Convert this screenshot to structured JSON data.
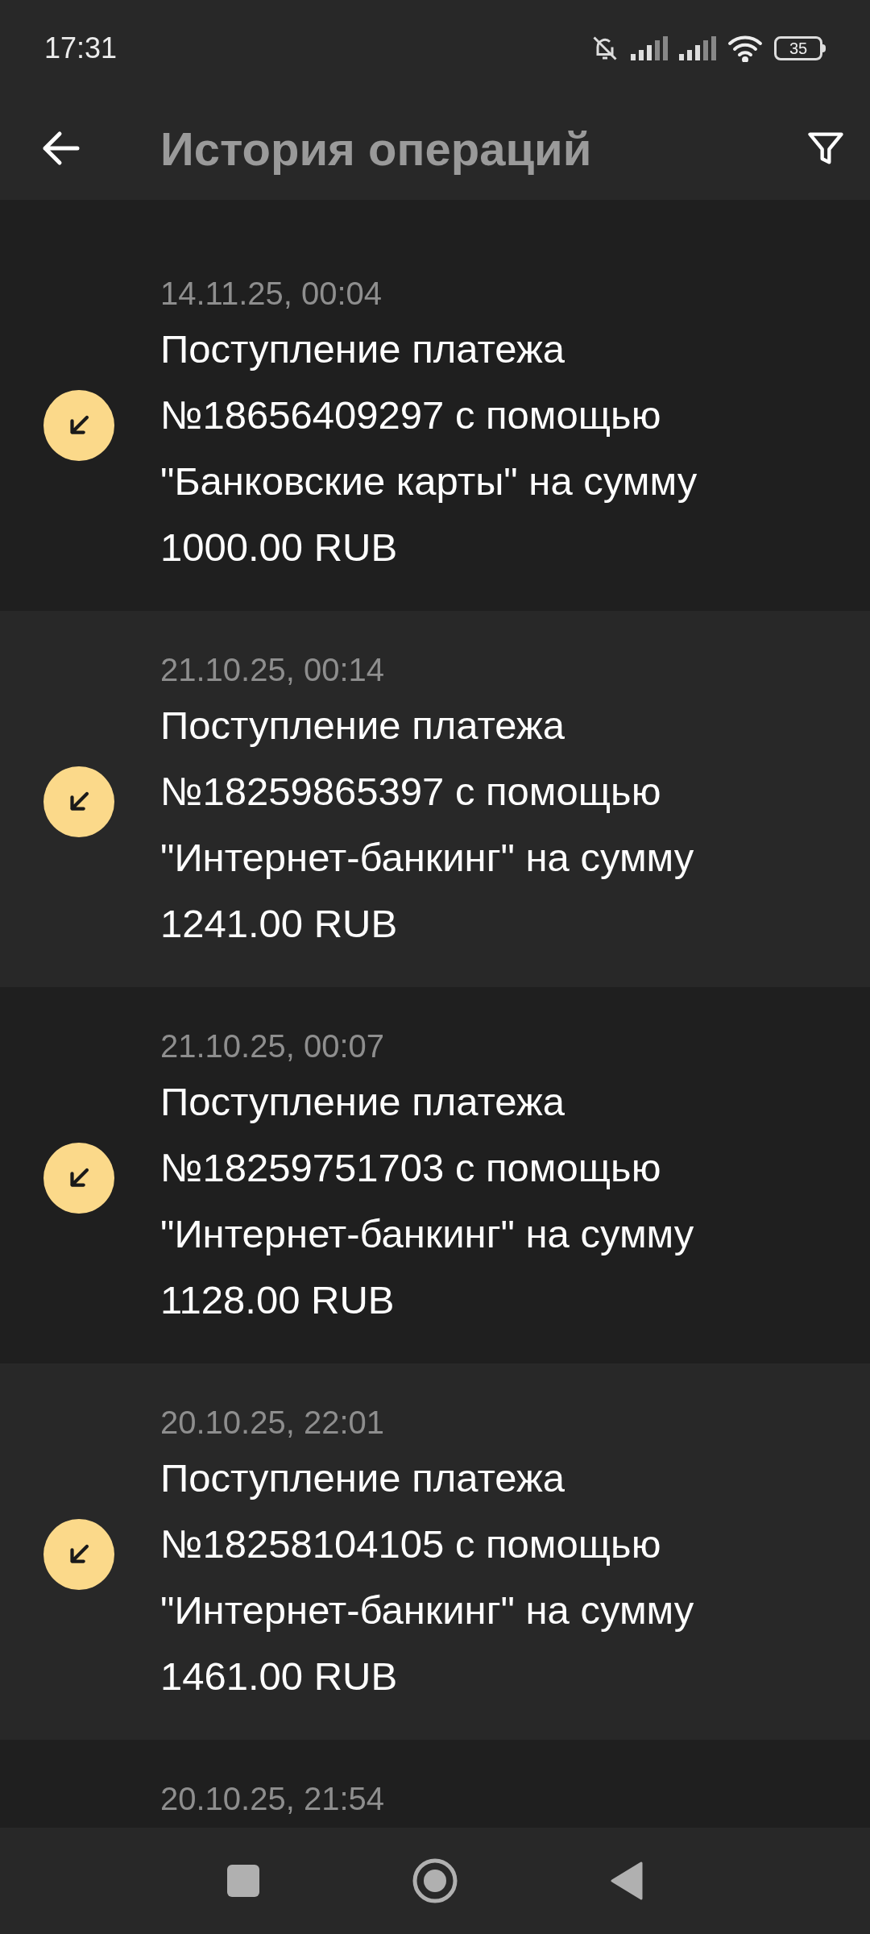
{
  "status_bar": {
    "time": "17:31",
    "battery": "35"
  },
  "header": {
    "title": "История операций"
  },
  "operations": [
    {
      "date": "14.11.25, 00:04",
      "text": "Поступление платежа №18656409297 с помощью \"Банковские карты\" на сумму 1000.00 RUB"
    },
    {
      "date": "21.10.25, 00:14",
      "text": "Поступление платежа №18259865397 с помощью \"Интернет-банкинг\" на сумму 1241.00 RUB"
    },
    {
      "date": "21.10.25, 00:07",
      "text": "Поступление платежа №18259751703 с помощью \"Интернет-банкинг\" на сумму 1128.00 RUB"
    },
    {
      "date": "20.10.25, 22:01",
      "text": "Поступление платежа №18258104105 с помощью \"Интернет-банкинг\" на сумму 1461.00 RUB"
    },
    {
      "date": "20.10.25, 21:54"
    }
  ]
}
